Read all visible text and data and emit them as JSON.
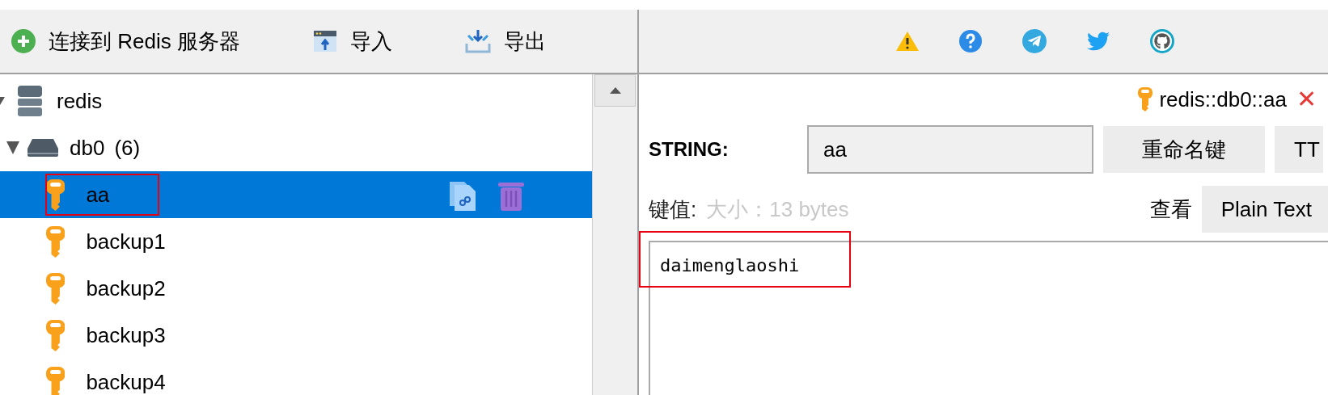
{
  "toolbar": {
    "buttons": [
      {
        "label": "连接到 Redis 服务器",
        "kind": "connect"
      },
      {
        "label": "导入",
        "kind": "import"
      },
      {
        "label": "导出",
        "kind": "export"
      }
    ],
    "links": [
      {
        "kind": "warning"
      },
      {
        "kind": "help"
      },
      {
        "kind": "telegram"
      },
      {
        "kind": "twitter"
      },
      {
        "kind": "github"
      }
    ]
  },
  "tree": [
    {
      "label": "redis",
      "expanded": true,
      "children": [
        {
          "label": "db0",
          "count": "(6)",
          "expanded": true,
          "children": [
            {
              "label": "aa",
              "selected": true,
              "highlighted": true
            },
            {
              "label": "backup1",
              "selected": false,
              "highlighted": false
            },
            {
              "label": "backup2",
              "selected": false,
              "highlighted": false
            },
            {
              "label": "backup3",
              "selected": false,
              "highlighted": false
            },
            {
              "label": "backup4",
              "selected": false,
              "highlighted": false
            }
          ]
        }
      ]
    }
  ],
  "tab": {
    "title": "redis::db0::aa",
    "close": "✕"
  },
  "editor": {
    "type_label": "STRING:",
    "key_name": "aa",
    "buttons": [
      "重命名键",
      "TT"
    ],
    "value_label": "键值:",
    "size": "大小：13 bytes",
    "view_label": "查看",
    "view_mode": "Plain Text",
    "value": "daimenglaoshi",
    "value_highlighted": true
  }
}
